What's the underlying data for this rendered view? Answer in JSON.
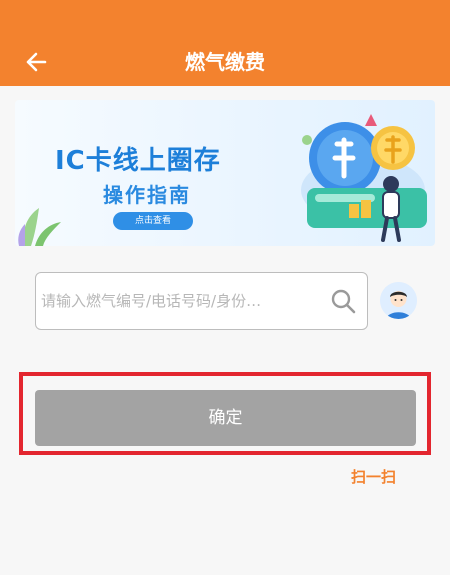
{
  "header": {
    "title": "燃气缴费",
    "background_color": "#f3822e",
    "back_icon": "arrow-left-icon"
  },
  "banner": {
    "title": "IC卡线上圈存",
    "subtitle": "操作指南",
    "button_label": "点击查看"
  },
  "search": {
    "value": "",
    "placeholder": "请输入燃气编号/电话号码/身份…",
    "icon": "search-icon"
  },
  "avatar": {
    "icon": "user-avatar-icon"
  },
  "confirm": {
    "label": "确定",
    "state": "disabled",
    "highlight_color": "#e3262f"
  },
  "scan": {
    "label": "扫一扫",
    "color": "#f3822e"
  }
}
